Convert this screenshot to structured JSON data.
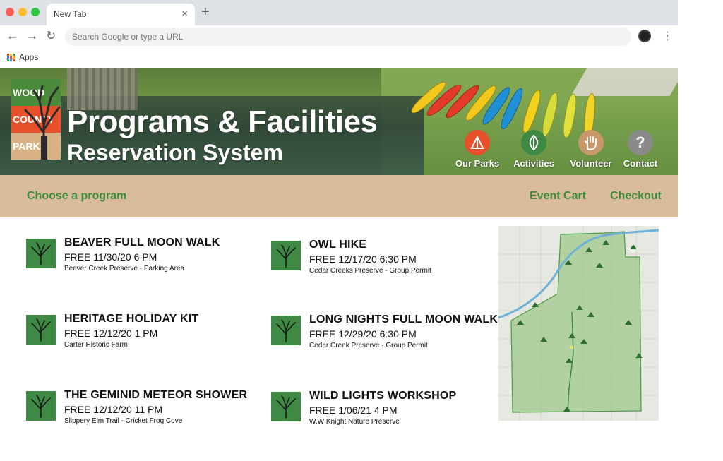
{
  "browser": {
    "tab_title": "New Tab",
    "tab_close": "×",
    "new_tab": "+",
    "back": "←",
    "forward": "→",
    "reload": "↻",
    "omnibox_placeholder": "Search Google or type a URL",
    "menu": "⋮",
    "bookmark_apps": "Apps"
  },
  "hero": {
    "logo": {
      "line1": "WOOD",
      "line2": "COUNTY",
      "line3": "PARKS"
    },
    "title_line1": "Programs & Facilities",
    "title_line2": "Reservation System",
    "nav": [
      {
        "label": "Our Parks",
        "icon": "tent-icon",
        "color": "#e7502a"
      },
      {
        "label": "Activities",
        "icon": "leaf-icon",
        "color": "#3e8a44"
      },
      {
        "label": "Volunteer",
        "icon": "hand-icon",
        "color": "#c8976a"
      },
      {
        "label": "Contact",
        "icon": "question-icon",
        "glyph": "?",
        "color": "#8a8a8a"
      }
    ]
  },
  "subnav": {
    "choose": "Choose a program",
    "cart": "Event Cart",
    "checkout": "Checkout"
  },
  "programs": [
    {
      "title": "BEAVER FULL MOON WALK",
      "meta": "FREE  11/30/20  6 PM",
      "location": "Beaver Creek Preserve - Parking Area"
    },
    {
      "title": "OWL HIKE",
      "meta": "FREE  12/17/20  6:30 PM",
      "location": "Cedar Creeks Preserve - Group Permit"
    },
    {
      "title": "HERITAGE HOLIDAY KIT",
      "meta": "FREE  12/12/20  1 PM",
      "location": "Carter Historic Farm"
    },
    {
      "title": "LONG NIGHTS FULL MOON WALK",
      "meta": "FREE  12/29/20  6:30 PM",
      "location": "Cedar Creek Preserve - Group Permit"
    },
    {
      "title": "THE GEMINID METEOR SHOWER",
      "meta": "FREE  12/12/20  11 PM",
      "location": "Slippery Elm Trail - Cricket Frog Cove"
    },
    {
      "title": "WILD LIGHTS WORKSHOP",
      "meta": "FREE  1/06/21  4 PM",
      "location": "W.W Knight Nature Preserve"
    }
  ],
  "colors": {
    "brand_green": "#3e8a3d",
    "tan": "#d8bc9c",
    "thumb_green": "#3e8a44"
  }
}
